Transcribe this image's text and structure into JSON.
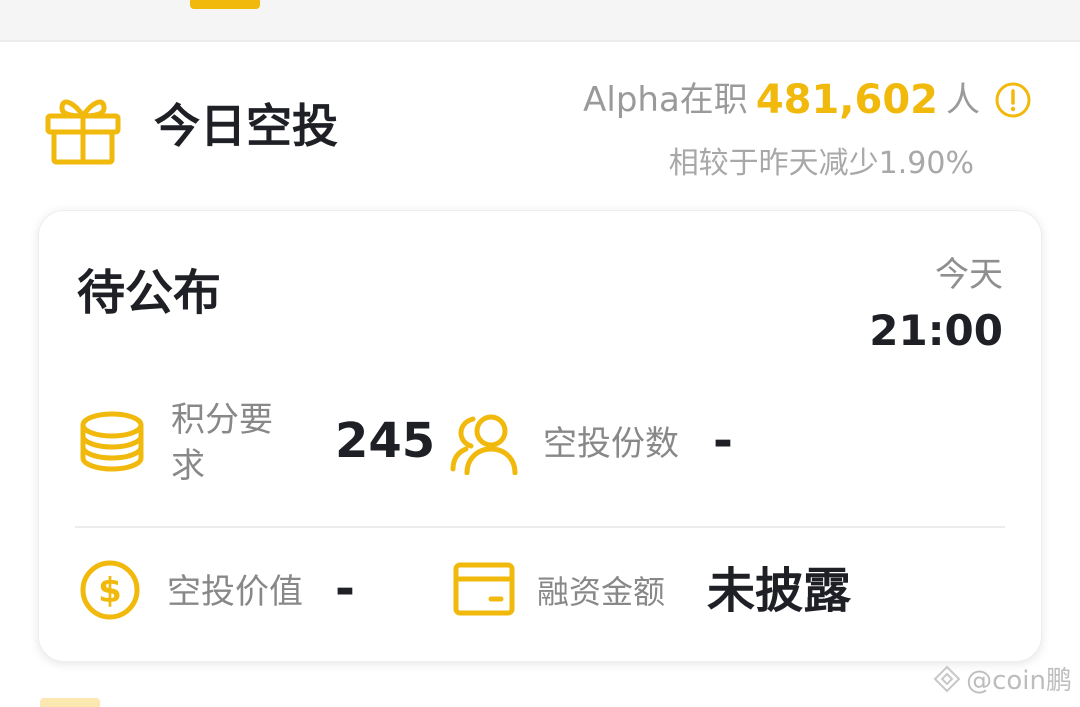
{
  "header": {
    "title": "今日空投",
    "alpha_prefix": "Alpha在职",
    "alpha_count": "481,602",
    "alpha_unit": "人",
    "compare_text": "相较于昨天减少1.90%"
  },
  "card": {
    "status": "待公布",
    "day": "今天",
    "time": "21:00",
    "points_label": "积分要求",
    "points_value": "245",
    "shares_label": "空投份数",
    "shares_value": "-",
    "value_label": "空投价值",
    "value_value": "-",
    "funding_label": "融资金额",
    "funding_value": "未披露"
  },
  "watermark": {
    "text": "@coin鹏"
  },
  "colors": {
    "accent": "#f0b90b",
    "text_primary": "#1e2026",
    "text_secondary": "#888888"
  },
  "icons": {
    "header": "gift-icon",
    "info": "info-circle-icon",
    "points": "coin-stack-icon",
    "shares": "users-icon",
    "value": "dollar-coin-icon",
    "funding": "wallet-icon"
  }
}
